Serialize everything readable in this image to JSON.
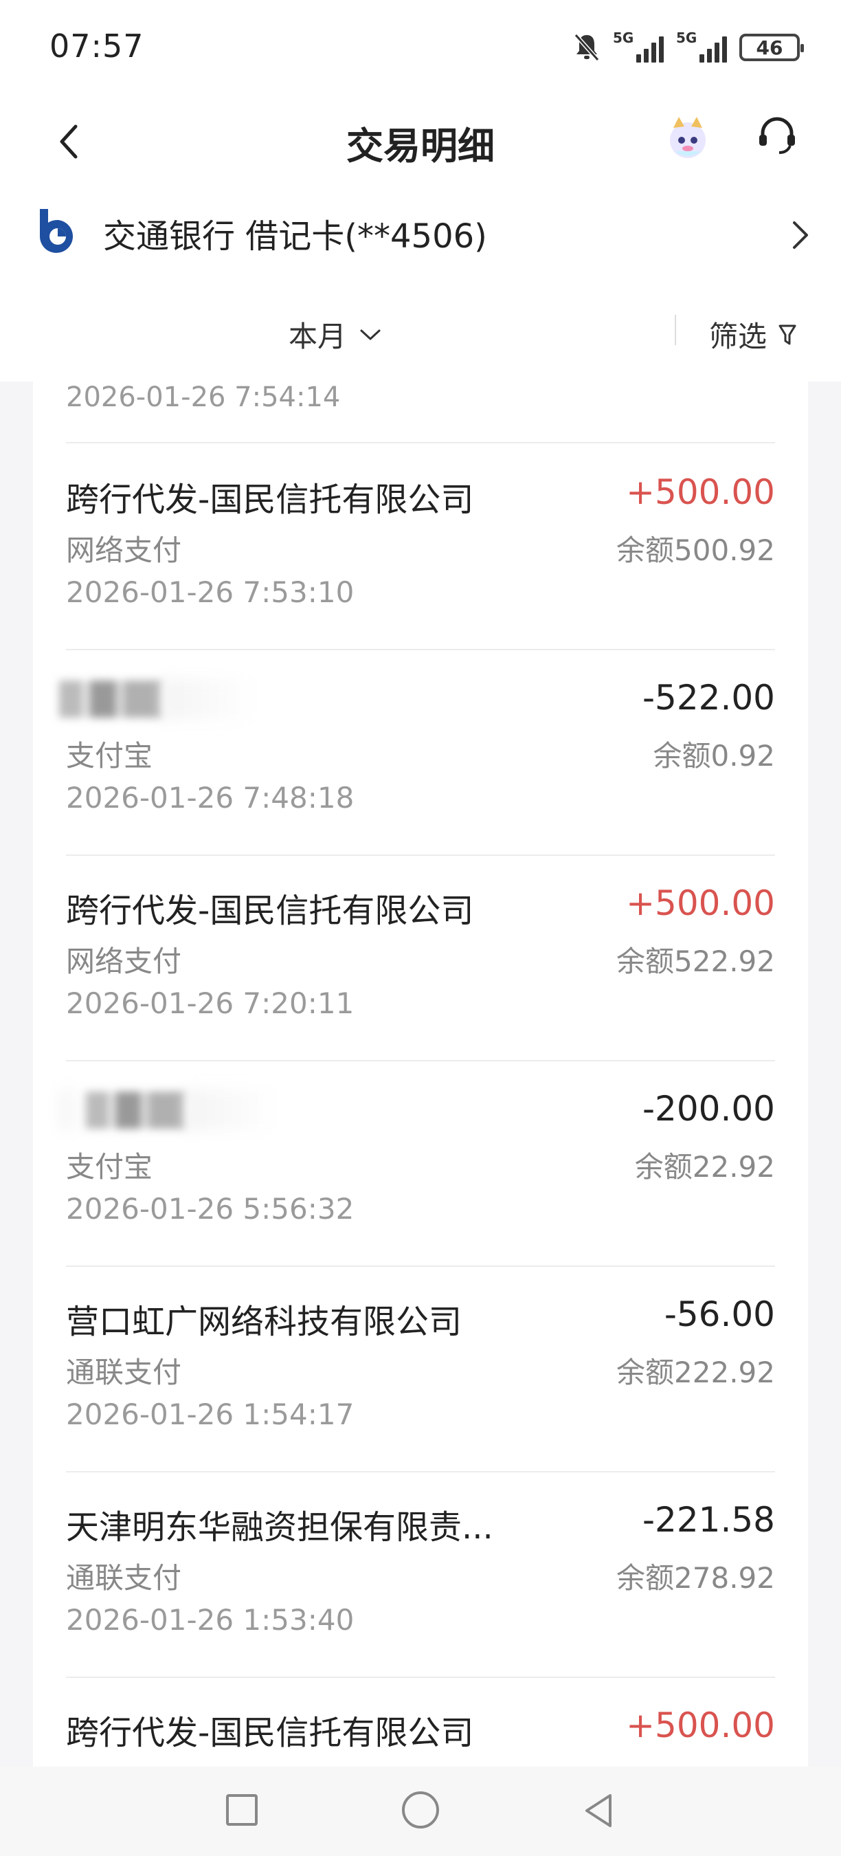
{
  "status_bar": {
    "time": "07:57",
    "network_1": "5G",
    "network_2": "5G",
    "battery": "46"
  },
  "header": {
    "title": "交易明细"
  },
  "account": {
    "bank_name": "交通银行 借记卡(**4506)"
  },
  "filter": {
    "month_label": "本月",
    "filter_label": "筛选"
  },
  "transactions_prev_time": "2026-01-26 7:54:14",
  "transactions": [
    {
      "name": "跨行代发-国民信托有限公司",
      "amount": "+500.00",
      "type": "income",
      "method": "网络支付",
      "balance": "余额500.92",
      "time": "2026-01-26 7:53:10"
    },
    {
      "name": "",
      "amount": "-522.00",
      "type": "expense",
      "method": "支付宝",
      "balance": "余额0.92",
      "time": "2026-01-26 7:48:18"
    },
    {
      "name": "跨行代发-国民信托有限公司",
      "amount": "+500.00",
      "type": "income",
      "method": "网络支付",
      "balance": "余额522.92",
      "time": "2026-01-26 7:20:11"
    },
    {
      "name": "",
      "amount": "-200.00",
      "type": "expense",
      "method": "支付宝",
      "balance": "余额22.92",
      "time": "2026-01-26 5:56:32"
    },
    {
      "name": "营口虹广网络科技有限公司",
      "amount": "-56.00",
      "type": "expense",
      "method": "通联支付",
      "balance": "余额222.92",
      "time": "2026-01-26 1:54:17"
    },
    {
      "name": "天津明东华融资担保有限责...",
      "amount": "-221.58",
      "type": "expense",
      "method": "通联支付",
      "balance": "余额278.92",
      "time": "2026-01-26 1:53:40"
    },
    {
      "name": "跨行代发-国民信托有限公司",
      "amount": "+500.00",
      "type": "income",
      "method": "",
      "balance": "",
      "time": ""
    }
  ],
  "colors": {
    "income": "#d9534f",
    "expense": "#222222",
    "bank_brand": "#1e4fa0"
  }
}
